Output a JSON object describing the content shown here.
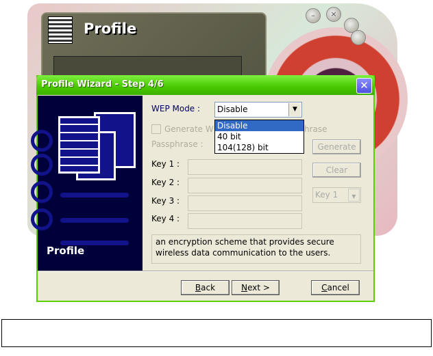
{
  "app": {
    "title": "Profile"
  },
  "wizard": {
    "title": "Profile Wizard - Step 4/6",
    "close_glyph": "✕",
    "side_label": "Profile",
    "wep_mode_label": "WEP Mode :",
    "wep_mode_value": "Disable",
    "wep_mode_options": [
      "Disable",
      "40 bit",
      "104(128) bit"
    ],
    "generate_checkbox_left": "Generate W",
    "generate_checkbox_right": "hrase",
    "passphrase_label": "Passphrase :",
    "generate_button": "Generate",
    "clear_button": "Clear",
    "keys": [
      {
        "label": "Key 1 :",
        "value": ""
      },
      {
        "label": "Key 2 :",
        "value": ""
      },
      {
        "label": "Key 3 :",
        "value": ""
      },
      {
        "label": "Key 4 :",
        "value": ""
      }
    ],
    "default_key_value": "Key 1",
    "description": "an encryption scheme that provides secure wireless data communication to the users.",
    "back_button": {
      "mn": "B",
      "rest": "ack"
    },
    "next_button": {
      "mn": "N",
      "rest": "ext >"
    },
    "cancel_button": {
      "mn": "C",
      "rest": "ancel"
    }
  },
  "colors": {
    "titlebar": "#48c800",
    "side_panel": "#00003a",
    "selection": "#316ac5"
  }
}
